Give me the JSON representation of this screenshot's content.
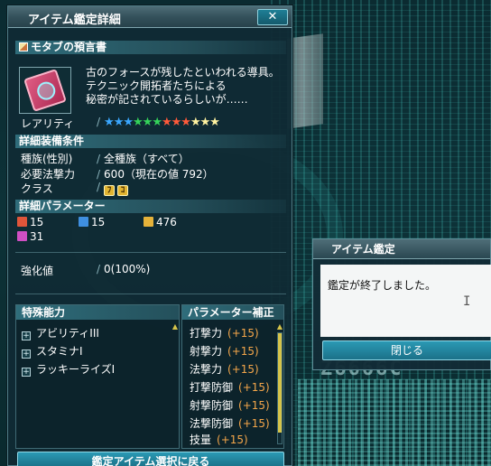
{
  "window": {
    "title": "アイテム鑑定詳細",
    "close_label": "✕",
    "item_name": "モタブの預言書",
    "description": [
      "古のフォースが残したといわれる導具。",
      "テクニック開拓者たちによる",
      "秘密が記されているらしいが……"
    ],
    "rarity_label": "レアリティ",
    "stars": [
      {
        "color": "#3aa7ff"
      },
      {
        "color": "#3aa7ff"
      },
      {
        "color": "#3aa7ff"
      },
      {
        "color": "#35d35a"
      },
      {
        "color": "#35d35a"
      },
      {
        "color": "#35d35a"
      },
      {
        "color": "#ff5a3a"
      },
      {
        "color": "#ff5a3a"
      },
      {
        "color": "#ff5a3a"
      },
      {
        "color": "#fff2a0"
      },
      {
        "color": "#fff2a0"
      },
      {
        "color": "#fff2a0"
      }
    ],
    "requirements": {
      "heading": "詳細装備条件",
      "race_label": "種族(性別)",
      "race_value": "全種族（すべて）",
      "power_label": "必要法撃力",
      "power_value": "600（現在の値 792）",
      "class_label": "クラス",
      "class_badges": [
        "ﾌ",
        "ｺ"
      ]
    },
    "parameters": {
      "heading": "詳細パラメーター",
      "items": [
        {
          "icon": "melee-attack-icon",
          "color": "#e0553a",
          "value": "15"
        },
        {
          "icon": "ranged-attack-icon",
          "color": "#3f8fe0",
          "value": "15"
        },
        {
          "icon": "tech-attack-icon",
          "color": "#e6b33a",
          "value": "476"
        },
        {
          "icon": "dexterity-icon",
          "color": "#d04fc4",
          "value": "31"
        }
      ]
    },
    "grind": {
      "label": "強化値",
      "value": "0(100%)"
    },
    "special_abilities": {
      "heading": "特殊能力",
      "items": [
        "アビリティIII",
        "スタミナI",
        "ラッキーライズI"
      ]
    },
    "param_bonus": {
      "heading": "パラメーター補正",
      "items": [
        {
          "label": "打撃力",
          "value": "(+15)"
        },
        {
          "label": "射撃力",
          "value": "(+15)"
        },
        {
          "label": "法撃力",
          "value": "(+15)"
        },
        {
          "label": "打撃防御",
          "value": "(+15)"
        },
        {
          "label": "射撃防御",
          "value": "(+15)"
        },
        {
          "label": "法撃防御",
          "value": "(+15)"
        },
        {
          "label": "技量",
          "value": "(+15)"
        }
      ]
    },
    "bottom_button": "鑑定アイテム選択に戻る"
  },
  "dialog": {
    "title": "アイテム鑑定",
    "message": "鑑定が終了しました。",
    "button": "閉じる"
  },
  "background": {
    "floor_text": "Z6666C"
  }
}
